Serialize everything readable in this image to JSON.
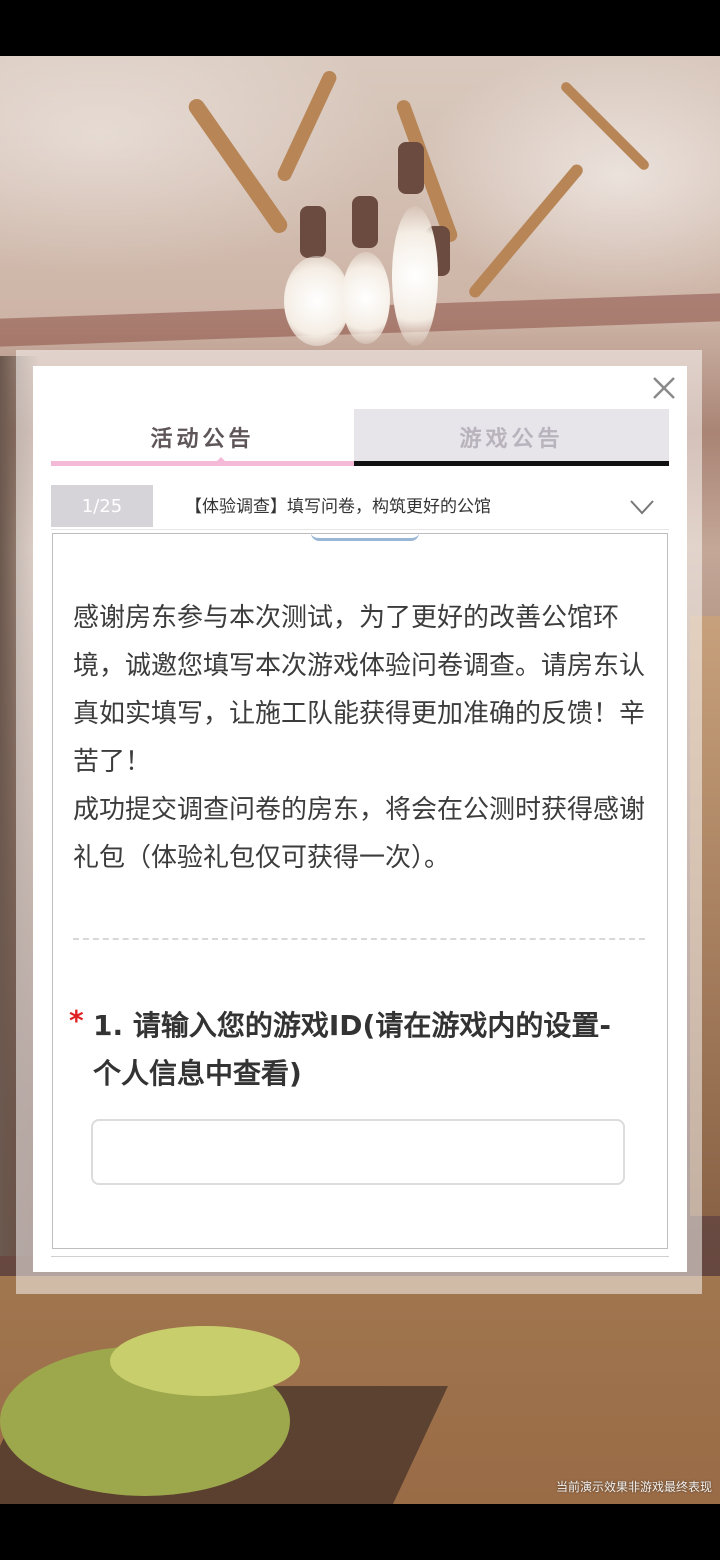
{
  "tabs": [
    {
      "label": "活动公告",
      "active": true
    },
    {
      "label": "游戏公告",
      "active": false
    }
  ],
  "notice": {
    "counter": "1/25",
    "title": "【体验调查】填写问卷，构筑更好的公馆"
  },
  "content": {
    "paragraph": "感谢房东参与本次测试，为了更好的改善公馆环境，诚邀您填写本次游戏体验问卷调查。请房东认真如实填写，让施工队能获得更加准确的反馈！辛苦了！\n成功提交调查问卷的房东，将会在公测时获得感谢礼包（体验礼包仅可获得一次）。",
    "question": {
      "required_mark": "*",
      "text": "1. 请输入您的游戏ID(请在游戏内的设置-个人信息中查看)",
      "answer_value": ""
    }
  },
  "watermark": "当前演示效果非游戏最终表现",
  "colors": {
    "active_tab_underline": "#f4b9d7",
    "required_mark": "#e02020"
  }
}
